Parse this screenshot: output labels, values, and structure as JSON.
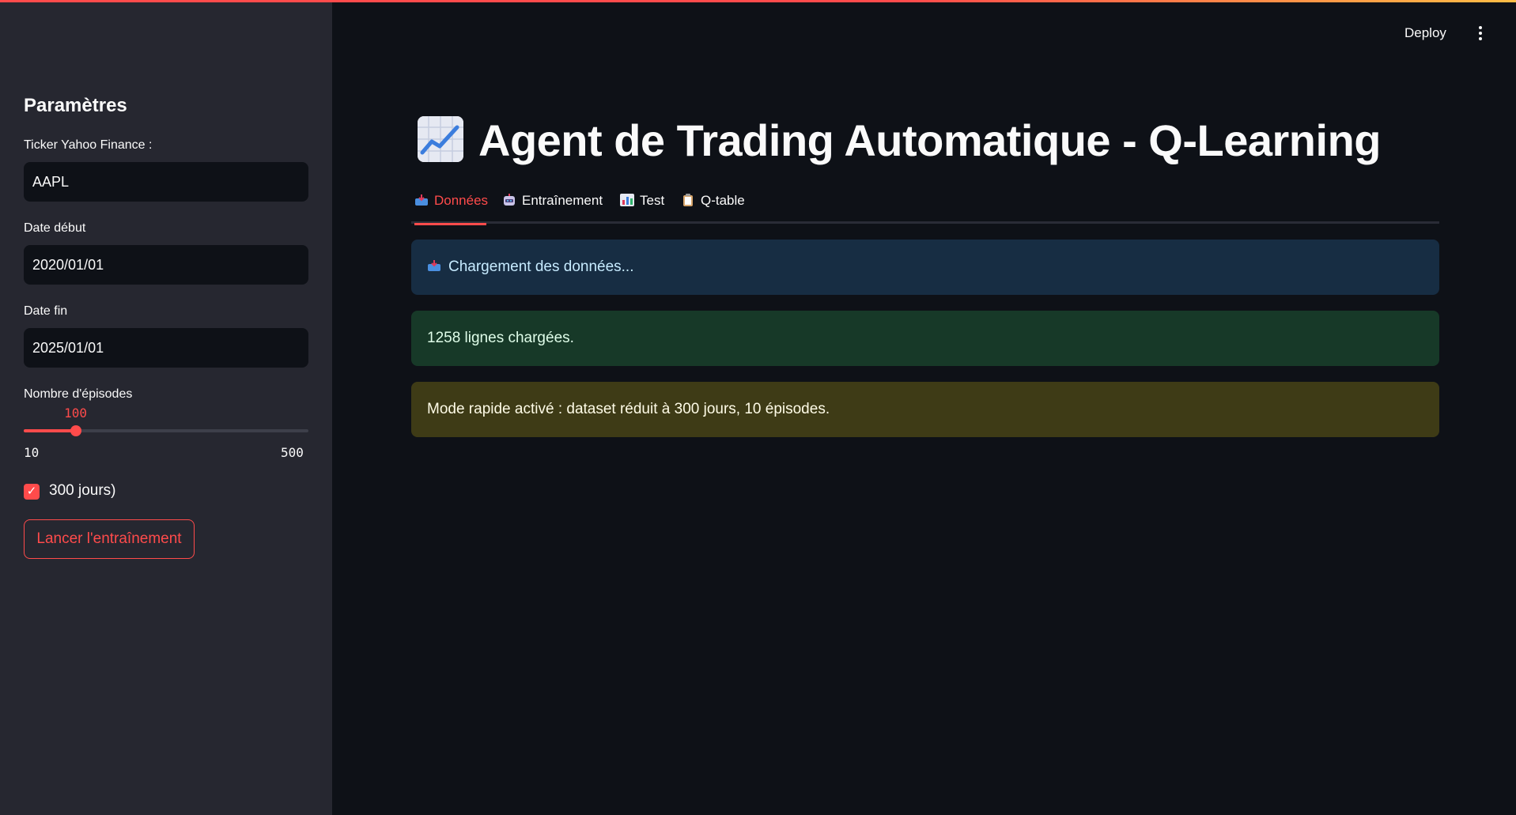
{
  "header": {
    "deploy_label": "Deploy",
    "menu_icon": "more-vertical-icon"
  },
  "sidebar": {
    "title": "Paramètres",
    "ticker": {
      "label": "Ticker Yahoo Finance :",
      "value": "AAPL"
    },
    "start_date": {
      "label": "Date début",
      "value": "2020/01/01"
    },
    "end_date": {
      "label": "Date fin",
      "value": "2025/01/01"
    },
    "episodes": {
      "label": "Nombre d'épisodes",
      "value": "100",
      "min": "10",
      "max": "500",
      "fraction": 0.1837
    },
    "fast_mode": {
      "checked": true,
      "label": "300 jours)"
    },
    "train_button": "Lancer l'entraînement"
  },
  "main": {
    "title": "Agent de Trading Automatique - Q-Learning",
    "title_icon": "chart-increasing-icon",
    "tabs": [
      {
        "label": "Données",
        "icon": "inbox-tray-icon",
        "active": true
      },
      {
        "label": "Entraînement",
        "icon": "robot-icon",
        "active": false
      },
      {
        "label": "Test",
        "icon": "bar-chart-icon",
        "active": false
      },
      {
        "label": "Q-table",
        "icon": "clipboard-icon",
        "active": false
      }
    ],
    "alerts": {
      "info": "Chargement des données...",
      "success": "1258 lignes chargées.",
      "warning": "Mode rapide activé : dataset réduit à 300 jours, 10 épisodes."
    }
  },
  "colors": {
    "accent": "#ff4b4b",
    "background": "#0e1117",
    "sidebar": "#262730",
    "info_bg": "#172d43",
    "success_bg": "#173928",
    "warning_bg": "#3e3b16"
  }
}
